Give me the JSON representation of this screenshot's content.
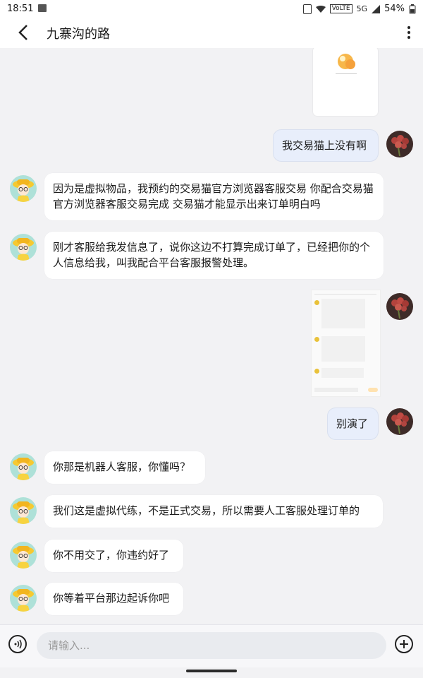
{
  "status_bar": {
    "time": "18:51",
    "network_badge": "VoLTE",
    "network_type": "5G",
    "battery": "54%"
  },
  "header": {
    "title": "九寨沟的路",
    "back_icon": "chevron-left-icon",
    "more_icon": "more-vertical-icon"
  },
  "messages": [
    {
      "side": "right",
      "type": "image"
    },
    {
      "side": "right",
      "type": "text",
      "text": "我交易猫上没有啊"
    },
    {
      "side": "left",
      "type": "text",
      "text": "因为是虚拟物品，我预约的交易猫官方浏览器客服交易 你配合交易猫官方浏览器客服交易完成 交易猫才能显示出来订单明白吗"
    },
    {
      "side": "left",
      "type": "text",
      "text": "刚才客服给我发信息了，说你这边不打算完成订单了，已经把你的个人信息给我，叫我配合平台客服报警处理。"
    },
    {
      "side": "right",
      "type": "image"
    },
    {
      "side": "right",
      "type": "text",
      "text": "别演了"
    },
    {
      "side": "left",
      "type": "text",
      "text": "你那是机器人客服，你懂吗？"
    },
    {
      "side": "left",
      "type": "text",
      "text": "我们这是虚拟代练，不是正式交易，所以需要人工客服处理订单的"
    },
    {
      "side": "left",
      "type": "text",
      "text": "你不用交了，你违约好了"
    },
    {
      "side": "left",
      "type": "text",
      "text": "你等着平台那边起诉你吧"
    }
  ],
  "input_bar": {
    "placeholder": "请输入...",
    "voice_icon": "voice-input-icon",
    "plus_icon": "plus-circle-icon"
  }
}
